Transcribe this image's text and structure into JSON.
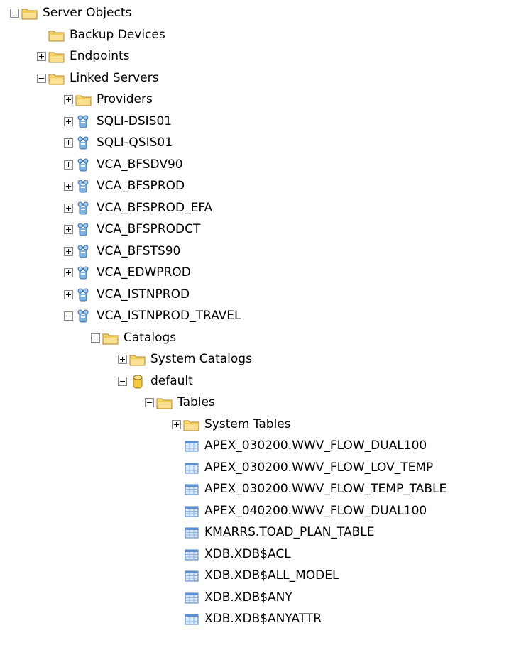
{
  "tree": {
    "nodes": [
      {
        "label": "Server Objects",
        "icon": "folder-icon",
        "toggle": "collapse",
        "level": 0
      },
      {
        "label": "Backup Devices",
        "icon": "folder-icon",
        "toggle": "none",
        "level": 1
      },
      {
        "label": "Endpoints",
        "icon": "folder-icon",
        "toggle": "expand",
        "level": 1
      },
      {
        "label": "Linked Servers",
        "icon": "folder-icon",
        "toggle": "collapse",
        "level": 1
      },
      {
        "label": "Providers",
        "icon": "folder-icon",
        "toggle": "expand",
        "level": 2
      },
      {
        "label": "SQLI-DSIS01",
        "icon": "linked-server-icon",
        "toggle": "expand",
        "level": 2
      },
      {
        "label": "SQLI-QSIS01",
        "icon": "linked-server-icon",
        "toggle": "expand",
        "level": 2
      },
      {
        "label": "VCA_BFSDV90",
        "icon": "linked-server-icon",
        "toggle": "expand",
        "level": 2
      },
      {
        "label": "VCA_BFSPROD",
        "icon": "linked-server-icon",
        "toggle": "expand",
        "level": 2
      },
      {
        "label": "VCA_BFSPROD_EFA",
        "icon": "linked-server-icon",
        "toggle": "expand",
        "level": 2
      },
      {
        "label": "VCA_BFSPRODCT",
        "icon": "linked-server-icon",
        "toggle": "expand",
        "level": 2
      },
      {
        "label": "VCA_BFSTS90",
        "icon": "linked-server-icon",
        "toggle": "expand",
        "level": 2
      },
      {
        "label": "VCA_EDWPROD",
        "icon": "linked-server-icon",
        "toggle": "expand",
        "level": 2
      },
      {
        "label": "VCA_ISTNPROD",
        "icon": "linked-server-icon",
        "toggle": "expand",
        "level": 2
      },
      {
        "label": "VCA_ISTNPROD_TRAVEL",
        "icon": "linked-server-icon",
        "toggle": "collapse",
        "level": 2
      },
      {
        "label": "Catalogs",
        "icon": "folder-icon",
        "toggle": "collapse",
        "level": 3
      },
      {
        "label": "System Catalogs",
        "icon": "folder-icon",
        "toggle": "expand",
        "level": 4
      },
      {
        "label": "default",
        "icon": "database-icon",
        "toggle": "collapse",
        "level": 4
      },
      {
        "label": "Tables",
        "icon": "folder-icon",
        "toggle": "collapse",
        "level": 5
      },
      {
        "label": "System Tables",
        "icon": "folder-icon",
        "toggle": "expand",
        "level": 6
      },
      {
        "label": "APEX_030200.WWV_FLOW_DUAL100",
        "icon": "table-icon",
        "toggle": "none",
        "level": 6
      },
      {
        "label": "APEX_030200.WWV_FLOW_LOV_TEMP",
        "icon": "table-icon",
        "toggle": "none",
        "level": 6
      },
      {
        "label": "APEX_030200.WWV_FLOW_TEMP_TABLE",
        "icon": "table-icon",
        "toggle": "none",
        "level": 6
      },
      {
        "label": "APEX_040200.WWV_FLOW_DUAL100",
        "icon": "table-icon",
        "toggle": "none",
        "level": 6
      },
      {
        "label": "KMARRS.TOAD_PLAN_TABLE",
        "icon": "table-icon",
        "toggle": "none",
        "level": 6
      },
      {
        "label": "XDB.XDB$ACL",
        "icon": "table-icon",
        "toggle": "none",
        "level": 6
      },
      {
        "label": "XDB.XDB$ALL_MODEL",
        "icon": "table-icon",
        "toggle": "none",
        "level": 6
      },
      {
        "label": "XDB.XDB$ANY",
        "icon": "table-icon",
        "toggle": "none",
        "level": 6
      },
      {
        "label": "XDB.XDB$ANYATTR",
        "icon": "table-icon",
        "toggle": "none",
        "level": 6
      }
    ]
  },
  "colors": {
    "folder_fill": "#f7d777",
    "folder_tab": "#f2c94c",
    "folder_edge": "#b48a2a",
    "database_fill": "#f5c842",
    "server_fill": "#7fb3e0",
    "table_header": "#5b8fd0",
    "table_cell": "#dbe8f7"
  }
}
